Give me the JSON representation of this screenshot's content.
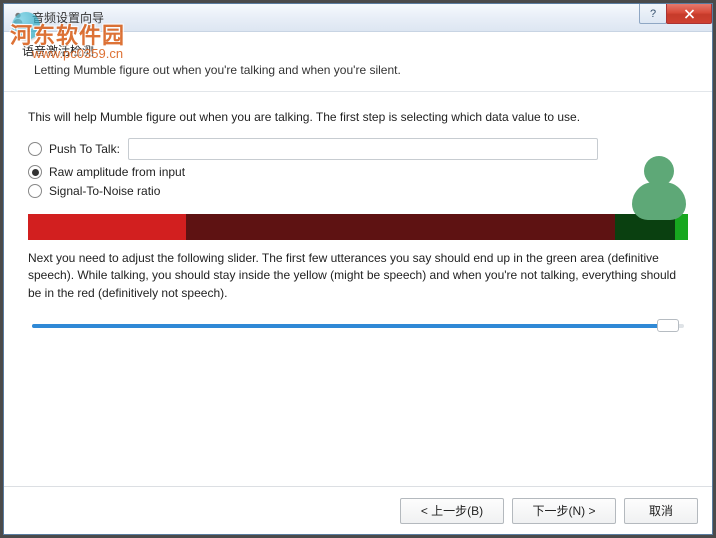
{
  "window": {
    "title": "音频设置向导",
    "help_tooltip": "?",
    "close_tooltip": "X"
  },
  "watermark": {
    "text": "河东软件园",
    "url": "www.pc0359.cn"
  },
  "header": {
    "title": "语音激活检测",
    "subtitle": "Letting Mumble figure out when you're talking and when you're silent."
  },
  "body": {
    "intro": "This will help Mumble figure out when you are talking. The first step is selecting which data value to use.",
    "options": {
      "ptt": {
        "label": "Push To Talk:",
        "value": "",
        "selected": false
      },
      "raw": {
        "label": "Raw amplitude from input",
        "selected": true
      },
      "snr": {
        "label": "Signal-To-Noise ratio",
        "selected": false
      }
    },
    "vu_meter": {
      "segments": [
        {
          "color": "#d21f1f",
          "width_pct": 24
        },
        {
          "color": "#5e1212",
          "width_pct": 65
        },
        {
          "color": "#0a4010",
          "width_pct": 9
        },
        {
          "color": "#17a71f",
          "width_pct": 2
        }
      ]
    },
    "help_text": "Next you need to adjust the following slider. The first few utterances you say should end up in the green area (definitive speech). While talking, you should stay inside the yellow (might be speech) and when you're not talking, everything should be in the red (definitively not speech).",
    "slider": {
      "value_pct": 97
    }
  },
  "footer": {
    "back": "< 上一步(B)",
    "next": "下一步(N) >",
    "cancel": "取消"
  }
}
